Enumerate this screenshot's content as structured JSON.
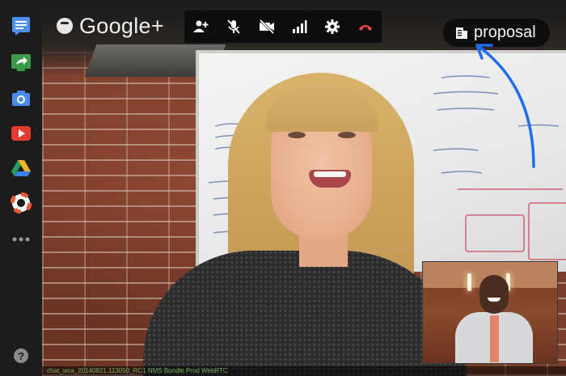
{
  "app": {
    "brand": "Google+"
  },
  "sidebar": {
    "items": [
      {
        "name": "chat-icon",
        "color": "#4d8ff2"
      },
      {
        "name": "share-screen-icon",
        "color": "#3a9a48"
      },
      {
        "name": "camera-icon",
        "color": "#4a8bf0"
      },
      {
        "name": "youtube-icon",
        "color": "#e33b2f"
      },
      {
        "name": "drive-icon",
        "color": "#f3b42c"
      },
      {
        "name": "hangout-toolbox-icon",
        "color": "#e85a36"
      },
      {
        "name": "more-apps-icon",
        "color": "#9a9a9a"
      },
      {
        "name": "help-icon",
        "color": "#8c8c8c"
      }
    ]
  },
  "toolbar": {
    "buttons": [
      "invite-people-icon",
      "mute-microphone-icon",
      "turn-off-camera-icon",
      "bandwidth-icon",
      "settings-icon",
      "end-call-icon"
    ],
    "end_call_color": "#e64a3c"
  },
  "document": {
    "label": "proposal",
    "icon": "document-icon"
  },
  "status": {
    "text": "chat_wca_20140821.113050_RC1 NMS Bundle Prod WebRTC"
  },
  "annotation": {
    "arrow_color": "#1f6cf0"
  }
}
